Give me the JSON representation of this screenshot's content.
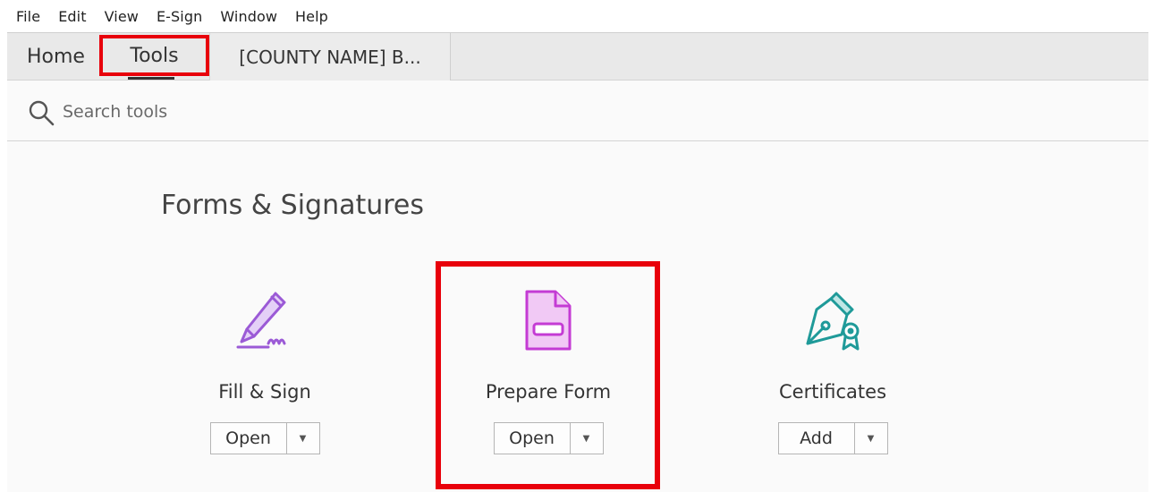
{
  "menu": {
    "items": [
      "File",
      "Edit",
      "View",
      "E-Sign",
      "Window",
      "Help"
    ]
  },
  "tabs": {
    "home": "Home",
    "tools": "Tools",
    "document": "[COUNTY NAME] B..."
  },
  "search": {
    "placeholder": "Search tools"
  },
  "section": {
    "title": "Forms & Signatures"
  },
  "tools": [
    {
      "label": "Fill & Sign",
      "button": "Open",
      "icon": "fill-sign-icon"
    },
    {
      "label": "Prepare Form",
      "button": "Open",
      "icon": "prepare-form-icon"
    },
    {
      "label": "Certificates",
      "button": "Add",
      "icon": "certificates-icon"
    }
  ],
  "colors": {
    "highlight": "#e8000b",
    "fill_sign": "#9b5ad6",
    "prepare_form": "#c43bd4",
    "certificates": "#1f9a99"
  }
}
